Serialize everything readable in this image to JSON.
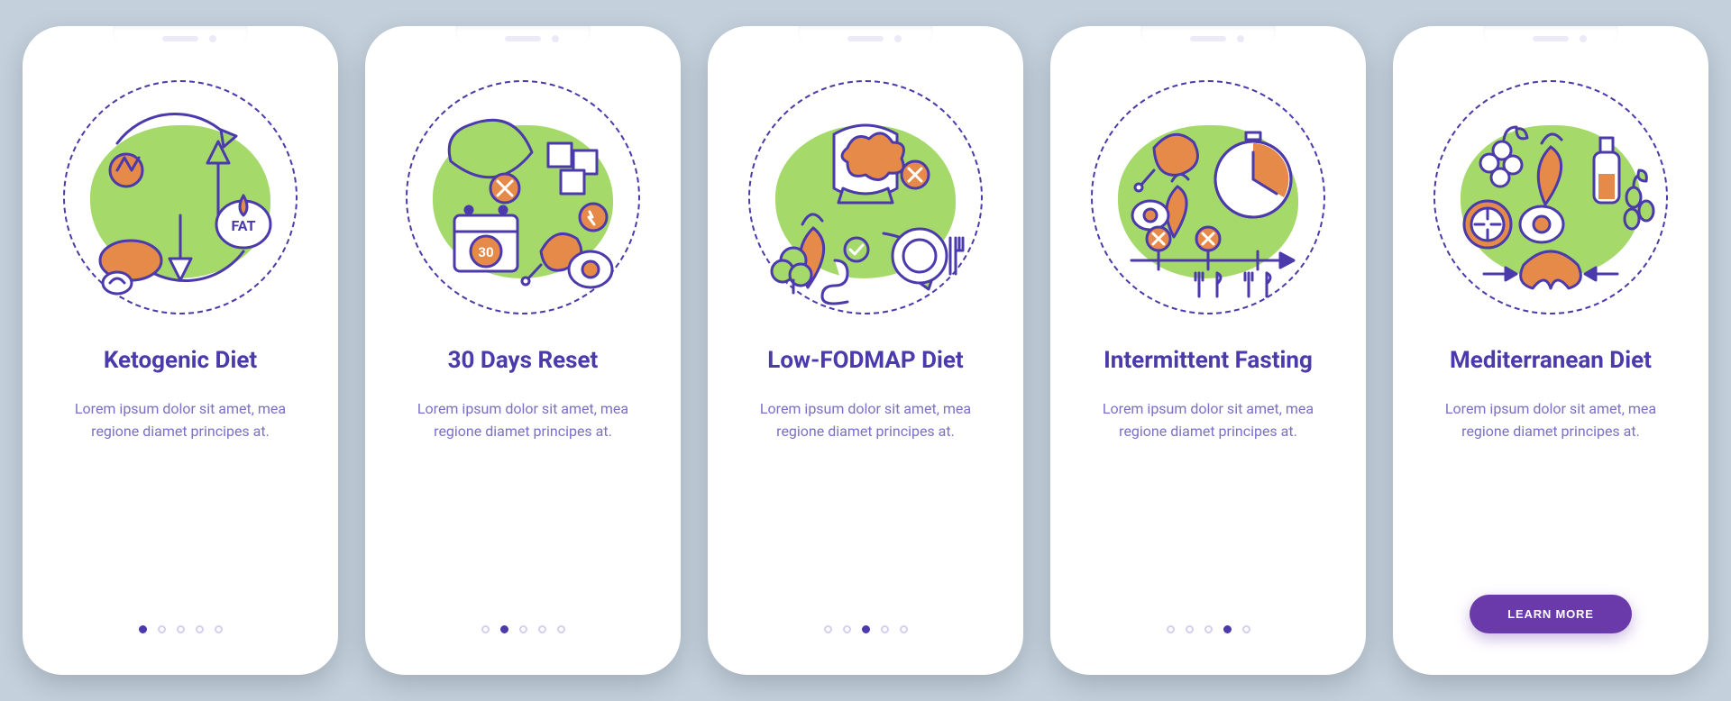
{
  "slides": [
    {
      "title": "Ketogenic Diet",
      "description": "Lorem ipsum dolor sit amet, mea regione diamet principes at.",
      "icon": "keto-illustration",
      "activeIndex": 0,
      "hasButton": false
    },
    {
      "title": "30 Days Reset",
      "description": "Lorem ipsum dolor sit amet, mea regione diamet principes at.",
      "icon": "reset-illustration",
      "activeIndex": 1,
      "hasButton": false
    },
    {
      "title": "Low-FODMAP Diet",
      "description": "Lorem ipsum dolor sit amet, mea regione diamet principes at.",
      "icon": "fodmap-illustration",
      "activeIndex": 2,
      "hasButton": false
    },
    {
      "title": "Intermittent Fasting",
      "description": "Lorem ipsum dolor sit amet, mea regione diamet principes at.",
      "icon": "fasting-illustration",
      "activeIndex": 3,
      "hasButton": false
    },
    {
      "title": "Mediterranean Diet",
      "description": "Lorem ipsum dolor sit amet, mea regione diamet principes at.",
      "icon": "mediterranean-illustration",
      "activeIndex": 4,
      "hasButton": true
    }
  ],
  "dotCount": 5,
  "buttonLabel": "LEARN MORE",
  "illustrationLabels": {
    "fat": "FAT",
    "calendar": "30"
  },
  "colors": {
    "purple": "#4b3aab",
    "green": "#a5d96a",
    "orange": "#e68a4a",
    "background": "#c4d1dd"
  }
}
